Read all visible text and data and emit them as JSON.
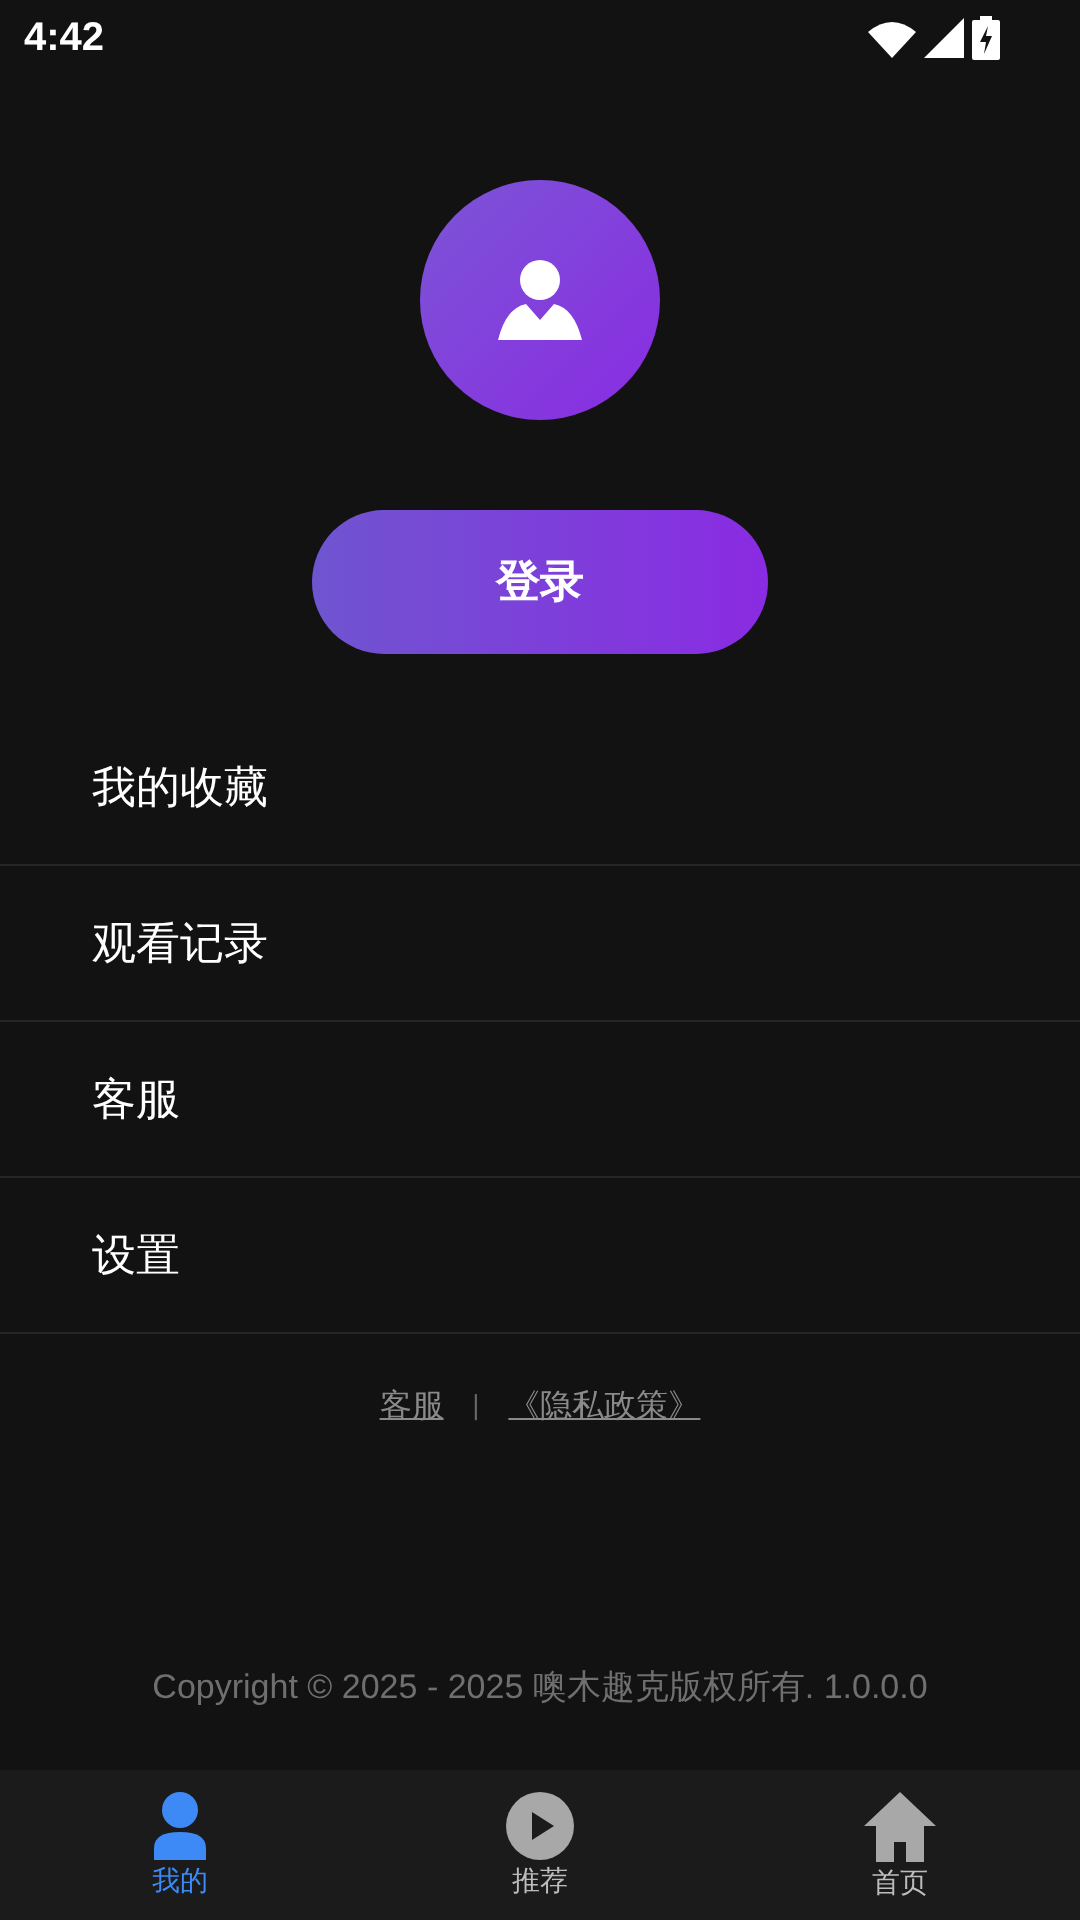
{
  "status_bar": {
    "time": "4:42"
  },
  "profile": {
    "login_button": "登录"
  },
  "menu": [
    {
      "label": "我的收藏"
    },
    {
      "label": "观看记录"
    },
    {
      "label": "客服"
    },
    {
      "label": "设置"
    }
  ],
  "links": {
    "service": "客服",
    "separator": "|",
    "privacy": "《隐私政策》"
  },
  "copyright": "Copyright © 2025 - 2025 噢木趣克版权所有. 1.0.0.0",
  "tabs": [
    {
      "label": "我的",
      "kind": "person",
      "selected": true
    },
    {
      "label": "推荐",
      "kind": "play",
      "selected": false
    },
    {
      "label": "首页",
      "kind": "home",
      "selected": false
    }
  ]
}
